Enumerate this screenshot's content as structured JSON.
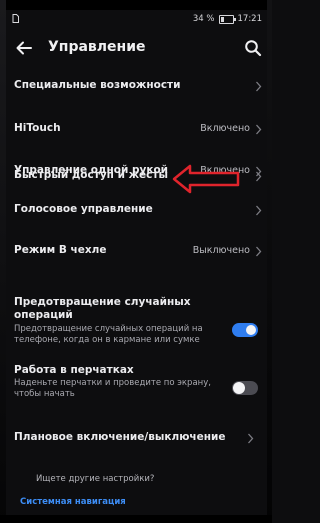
{
  "status_bar": {
    "sim_icon": "sim-card-icon",
    "battery_text": "34 %",
    "battery_level": 0.34,
    "time": "17:21"
  },
  "header": {
    "title": "Управление",
    "back_icon": "arrow-left-icon",
    "search_icon": "search-icon"
  },
  "items": [
    {
      "label": "Специальные возможности"
    },
    {
      "label": "HiTouch",
      "value": "Включено"
    },
    {
      "label": "Управление одной рукой",
      "value": "Включено"
    },
    {
      "label": "Быстрый доступ и жесты"
    },
    {
      "label": "Голосовое управление"
    },
    {
      "label": "Режим В чехле",
      "value": "Выключено"
    },
    {
      "label": "Предотвращение случайных операций",
      "sub": "Предотвращение случайных операций на телефоне, когда он в кармане или сумке",
      "toggle": true
    },
    {
      "label": "Работа в перчатках",
      "sub": "Наденьте перчатки и проведите по экрану, чтобы начать",
      "toggle": false
    },
    {
      "label": "Плановое включение/выключение"
    }
  ],
  "footer": {
    "question": "Ищете другие настройки?",
    "link": "Системная навигация"
  },
  "annotation": {
    "color": "#e0242c",
    "icon": "red-arrow-annotation"
  },
  "colors": {
    "accent": "#2f7df0",
    "link": "#3d8df5",
    "background": "#0d0d0f"
  }
}
